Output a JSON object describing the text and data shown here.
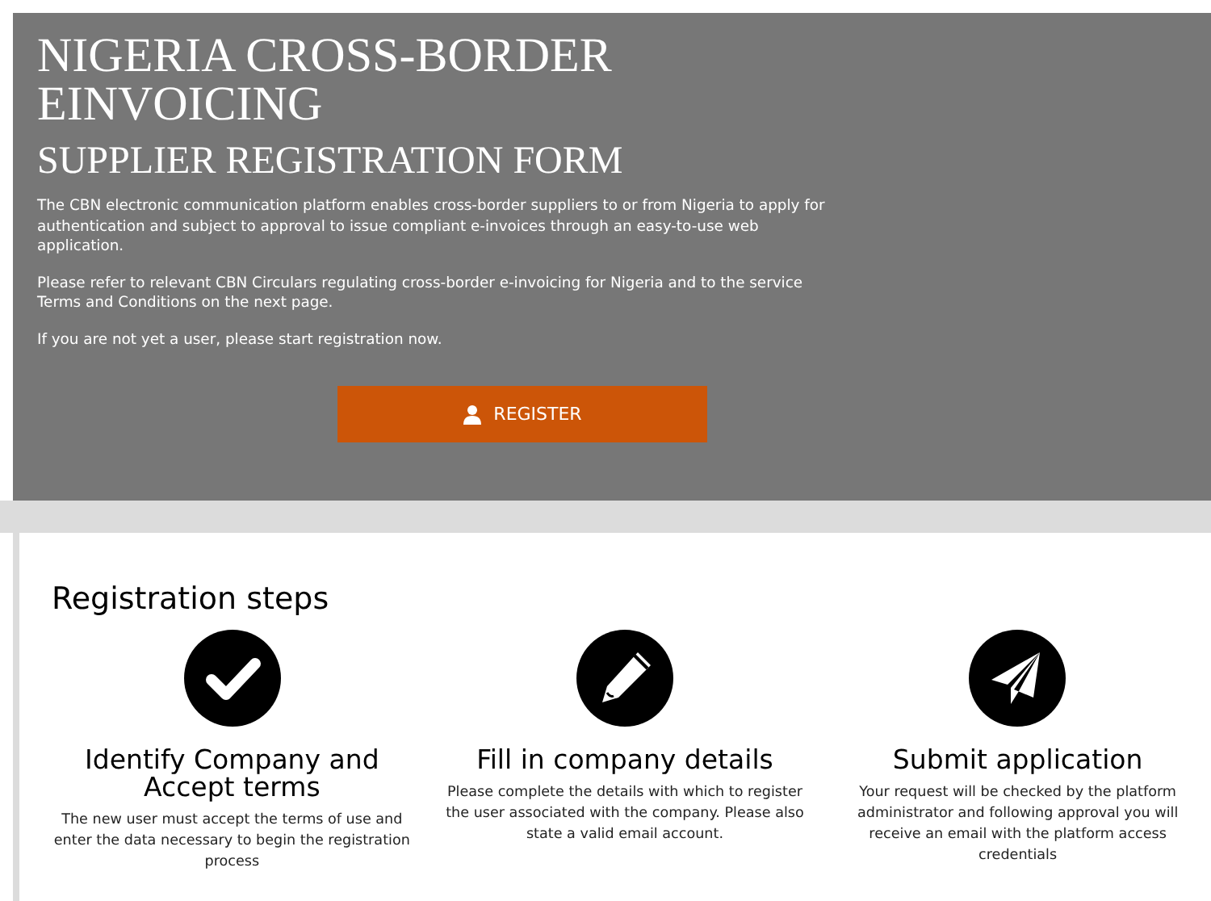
{
  "hero": {
    "title": "NIGERIA CROSS-BORDER EINVOICING",
    "subtitle": "SUPPLIER REGISTRATION FORM",
    "paragraphs": [
      "The CBN electronic communication platform enables cross-border suppliers to or from Nigeria to apply for authentication and subject to approval to issue compliant e-invoices through an easy-to-use web application.",
      "Please refer to relevant CBN Circulars regulating cross-border e-invoicing for Nigeria and to the service Terms and Conditions on the next page.",
      "If you are not yet a user, please start registration now."
    ],
    "button": "REGISTER"
  },
  "steps_section": {
    "heading": "Registration steps",
    "steps": [
      {
        "kind": "check",
        "title": "Identify Company and Accept terms",
        "text": "The new user must accept the terms of use and enter the data necessary to begin the registration process"
      },
      {
        "kind": "pencil",
        "title": "Fill in company details",
        "text": "Please complete the details with which to register the user associated with the company. Please also state a valid email account."
      },
      {
        "kind": "send",
        "title": "Submit application",
        "text": "Your request will be checked by the platform administrator and following approval you will receive an email with the platform access credentials"
      }
    ]
  }
}
